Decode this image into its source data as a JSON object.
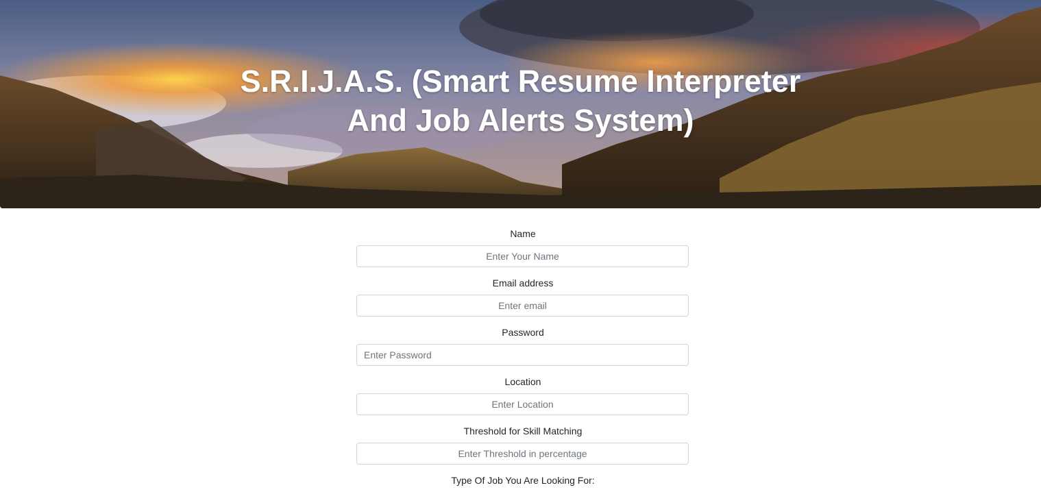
{
  "header": {
    "title_line1": "S.R.I.J.A.S. (Smart Resume Interpreter",
    "title_line2": "And Job Alerts System)"
  },
  "form": {
    "name": {
      "label": "Name",
      "placeholder": "Enter Your Name"
    },
    "email": {
      "label": "Email address",
      "placeholder": "Enter email"
    },
    "password": {
      "label": "Password",
      "placeholder": "Enter Password"
    },
    "location": {
      "label": "Location",
      "placeholder": "Enter Location"
    },
    "threshold": {
      "label": "Threshold for Skill Matching",
      "placeholder": "Enter Threshold in percentage"
    },
    "job_type": {
      "label": "Type Of Job You Are Looking For:"
    }
  },
  "colors": {
    "label_text": "#212529",
    "input_border": "#ced4da",
    "placeholder": "#6c757d"
  }
}
